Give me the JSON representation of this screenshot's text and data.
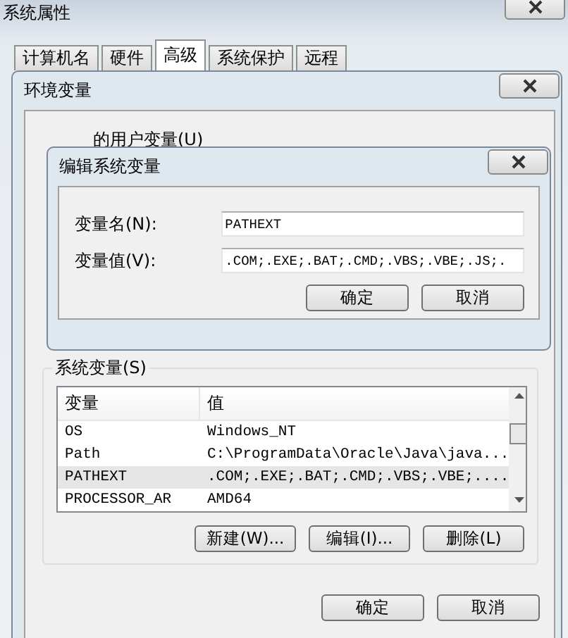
{
  "window": {
    "title": "系统属性"
  },
  "tabs": [
    {
      "label": "计算机名",
      "selected": false
    },
    {
      "label": "硬件",
      "selected": false
    },
    {
      "label": "高级",
      "selected": true
    },
    {
      "label": "系统保护",
      "selected": false
    },
    {
      "label": "远程",
      "selected": false
    }
  ],
  "env_dialog": {
    "title": "环境变量",
    "user_variables_label": "的用户变量(U)",
    "system_variables": {
      "label": "系统变量(S)",
      "columns": [
        "变量",
        "值"
      ],
      "rows": [
        {
          "name": "OS",
          "value": "Windows_NT",
          "selected": false
        },
        {
          "name": "Path",
          "value": "C:\\ProgramData\\Oracle\\Java\\java...",
          "selected": false
        },
        {
          "name": "PATHEXT",
          "value": ".COM;.EXE;.BAT;.CMD;.VBS;.VBE;....",
          "selected": true
        },
        {
          "name": "PROCESSOR_AR",
          "value": "AMD64",
          "selected": false
        }
      ],
      "buttons": [
        "新建(W)...",
        "编辑(I)...",
        "删除(L)"
      ]
    },
    "buttons": [
      "确定",
      "取消"
    ]
  },
  "edit_dialog": {
    "title": "编辑系统变量",
    "fields": [
      {
        "label": "变量名(N):",
        "value": "PATHEXT"
      },
      {
        "label": "变量值(V):",
        "value": ".COM;.EXE;.BAT;.CMD;.VBS;.VBE;.JS;."
      }
    ],
    "buttons": [
      "确定",
      "取消"
    ]
  }
}
